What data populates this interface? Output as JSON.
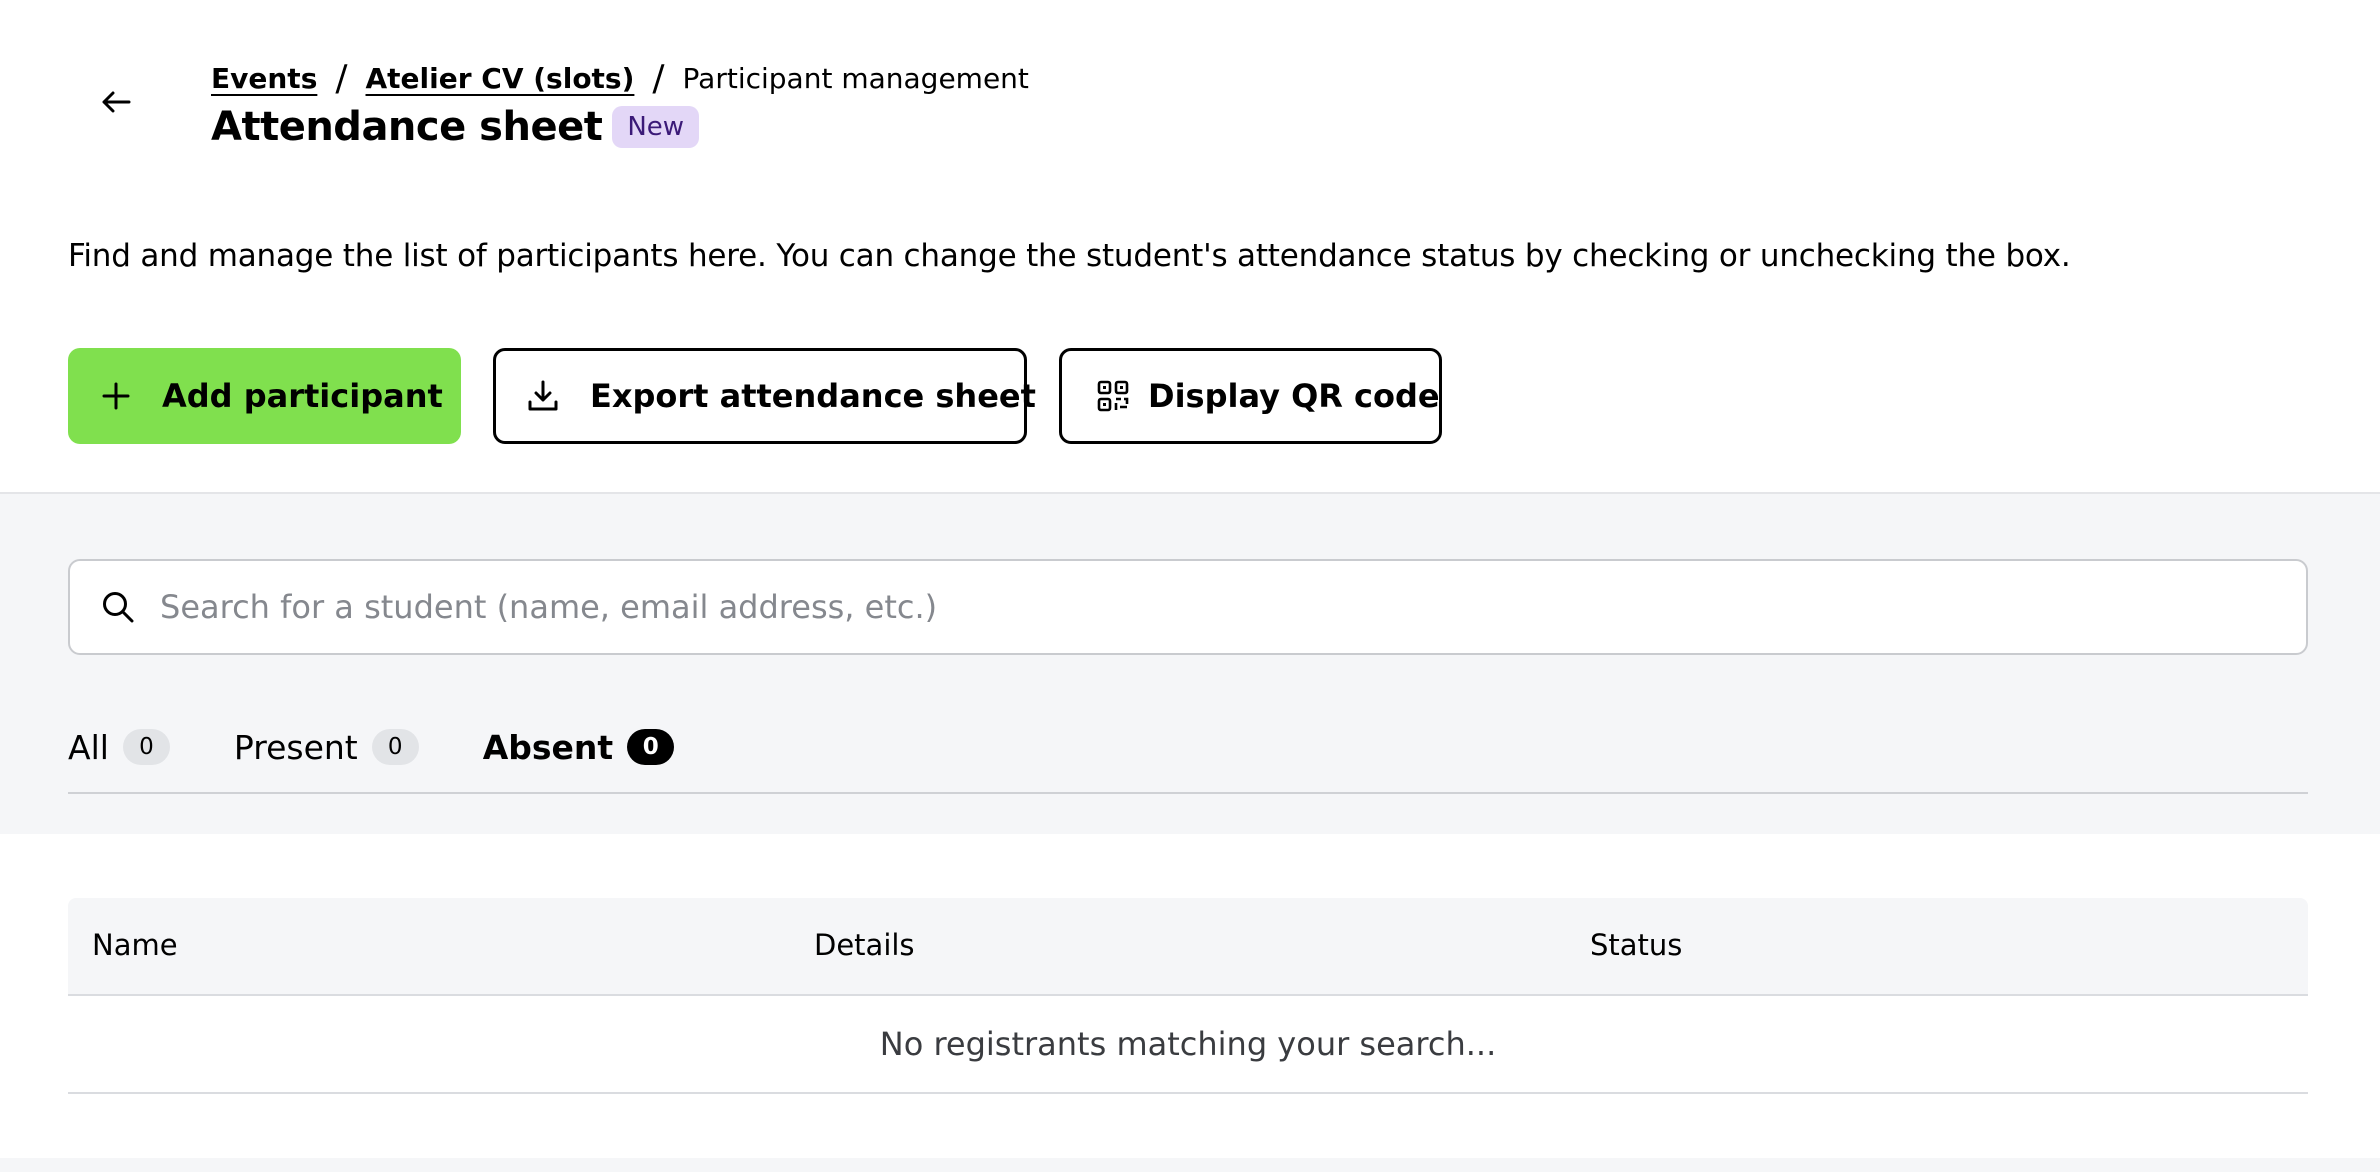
{
  "header": {
    "breadcrumb": {
      "events": "Events",
      "event_name": "Atelier CV (slots)",
      "current": "Participant management",
      "separator": "/"
    },
    "title": "Attendance sheet",
    "badge": "New"
  },
  "description": "Find and manage the list of participants here. You can change the student's attendance status by checking or unchecking the box.",
  "actions": {
    "add_participant": "Add participant",
    "export_sheet": "Export attendance sheet",
    "display_qr": "Display QR code"
  },
  "search": {
    "placeholder": "Search for a student (name, email address, etc.)",
    "value": ""
  },
  "tabs": [
    {
      "label": "All",
      "count": "0",
      "active": false
    },
    {
      "label": "Present",
      "count": "0",
      "active": false
    },
    {
      "label": "Absent",
      "count": "0",
      "active": true
    }
  ],
  "table": {
    "columns": {
      "name": "Name",
      "details": "Details",
      "status": "Status"
    },
    "empty_message": "No registrants matching your search..."
  },
  "colors": {
    "primary_button": "#80e04e",
    "badge_bg": "#e3d7f7",
    "badge_text": "#3b1a78",
    "section_bg": "#f5f6f8"
  },
  "icons": {
    "back": "arrow-left-icon",
    "add": "plus-icon",
    "export": "download-icon",
    "qr": "qr-code-icon",
    "search": "search-icon"
  }
}
